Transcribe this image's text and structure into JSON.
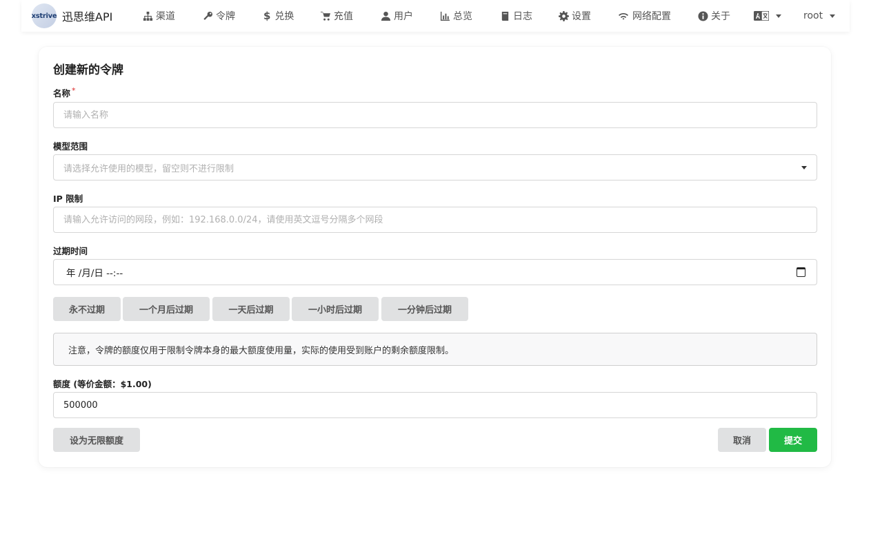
{
  "nav": {
    "brand_logo_text": "xstrive",
    "brand_name": "迅思维API",
    "items": [
      {
        "label": "渠道",
        "icon": "sitemap-icon"
      },
      {
        "label": "令牌",
        "icon": "key-icon"
      },
      {
        "label": "兑换",
        "icon": "dollar-icon"
      },
      {
        "label": "充值",
        "icon": "cart-icon"
      },
      {
        "label": "用户",
        "icon": "user-icon"
      },
      {
        "label": "总览",
        "icon": "bar-chart-icon"
      },
      {
        "label": "日志",
        "icon": "book-icon"
      },
      {
        "label": "设置",
        "icon": "gear-icon"
      },
      {
        "label": "网络配置",
        "icon": "wifi-icon"
      },
      {
        "label": "关于",
        "icon": "info-icon"
      }
    ],
    "language_icon": "translate-icon",
    "user": "root"
  },
  "form": {
    "title": "创建新的令牌",
    "name_label": "名称",
    "name_required_mark": "*",
    "name_placeholder": "请输入名称",
    "model_label": "模型范围",
    "model_placeholder": "请选择允许使用的模型，留空则不进行限制",
    "ip_label": "IP 限制",
    "ip_placeholder": "请输入允许访问的网段，例如：192.168.0.0/24，请使用英文逗号分隔多个网段",
    "expire_label": "过期时间",
    "expire_value": "年 /月/日 --:--",
    "expire_buttons": [
      "永不过期",
      "一个月后过期",
      "一天后过期",
      "一小时后过期",
      "一分钟后过期"
    ],
    "notice": "注意，令牌的额度仅用于限制令牌本身的最大额度使用量，实际的使用受到账户的剩余额度限制。",
    "quota_label": "额度 (等价金额：$1.00)",
    "quota_value": "500000",
    "unlimited_button": "设为无限额度",
    "cancel_button": "取消",
    "submit_button": "提交"
  },
  "colors": {
    "submit": "#21ba45",
    "button_gray": "#e0e1e2",
    "required": "#db2828"
  }
}
